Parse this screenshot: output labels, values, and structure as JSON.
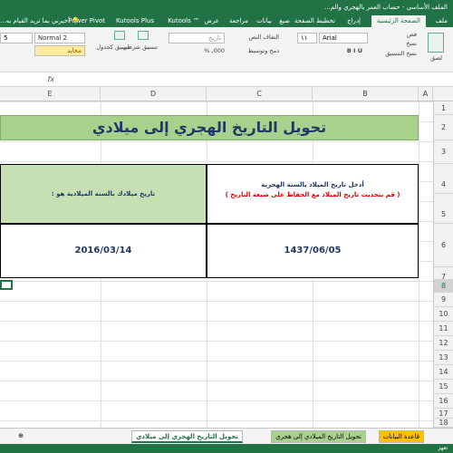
{
  "window": {
    "title": "الملف الأساسي - حساب العمر بالهجري والم..."
  },
  "tell_me": "أخبرني بما تريد القيام به...",
  "ribbon_tabs": [
    "ملف",
    "الصفحة الرئيسية",
    "إدراج",
    "تخطيط الصفحة",
    "صيغ",
    "بيانات",
    "مراجعة",
    "عرض",
    "Kutools ™",
    "Kutools Plus",
    "Power Pivot"
  ],
  "ribbon": {
    "paste": "لصق",
    "cut": "قص",
    "copy": "نسخ",
    "format_painter": "نسخ التنسيق",
    "font_name": "Arial",
    "font_size": "١١",
    "wrap_text": "التفاف النص",
    "merge_center": "دمج وتوسيط",
    "number_format": "تاريخ",
    "conditional_format": "تنسيق شرطي",
    "format_as_table": "تنسيق كجدول",
    "style_normal2": "Normal 2",
    "style_5": "5",
    "style_natural": "محايد"
  },
  "columns": [
    "A",
    "B",
    "C",
    "D",
    "E"
  ],
  "rows": [
    "1",
    "2",
    "3",
    "4",
    "5",
    "6",
    "7",
    "8",
    "9",
    "10",
    "11",
    "12",
    "13",
    "14",
    "15",
    "16",
    "17",
    "18"
  ],
  "selected_row": "8",
  "sheet": {
    "title": "تحويل التاريخ الهجري إلى ميلادي",
    "input_label_1": "أدخل تاريخ الميلاد بالسنة الهجرية",
    "input_label_2": "( قم بتحديث تاريخ الميلاد مع الحفاظ على صيغة التاريخ )",
    "output_label": "تاريخ ميلادك بالسنة الميلادية هو :",
    "hijri_value": "1437/06/05",
    "gregorian_value": "2016/03/14"
  },
  "sheet_tabs": [
    {
      "label": "قاعدة البيانات",
      "color": "#ffc000"
    },
    {
      "label": "تحويل التاريخ الميلادي إلى هجري",
      "color": "#a9d18e"
    },
    {
      "label": "تحويل التاريخ الهجري إلى ميلادي",
      "color": "#ffffff"
    }
  ],
  "status": "تعهز",
  "colors": {
    "excel_green": "#217346",
    "title_fill": "#a9d18e",
    "header_fill": "#c6e0b4",
    "text_navy": "#1f3864",
    "note_red": "#e00000"
  }
}
